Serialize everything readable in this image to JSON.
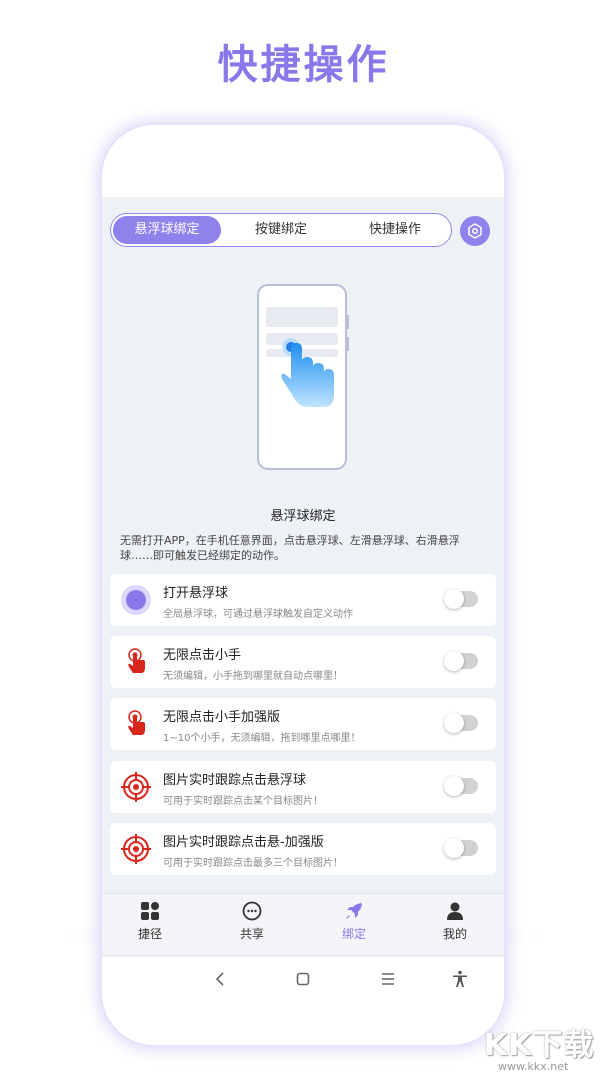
{
  "headline": "快捷操作",
  "segment": {
    "tabs": [
      {
        "label": "悬浮球绑定",
        "active": true
      },
      {
        "label": "按键绑定",
        "active": false
      },
      {
        "label": "快捷操作",
        "active": false
      }
    ],
    "settings_icon": "hexagon-settings-icon"
  },
  "section": {
    "title": "悬浮球绑定",
    "description": "无需打开APP，在手机任意界面，点击悬浮球、左滑悬浮球、右滑悬浮球……即可触发已经绑定的动作。"
  },
  "features": [
    {
      "title": "打开悬浮球",
      "subtitle": "全局悬浮球，可通过悬浮球触发自定义动作",
      "icon": "floating-ball-icon",
      "enabled": false
    },
    {
      "title": "无限点击小手",
      "subtitle": "无须编辑，小手拖到哪里就自动点哪里！",
      "icon": "tap-hand-icon",
      "enabled": false
    },
    {
      "title": "无限点击小手加强版",
      "subtitle": "1~10个小手，无须编辑，拖到哪里点哪里！",
      "icon": "tap-hand-icon",
      "enabled": false
    },
    {
      "title": "图片实时跟踪点击悬浮球",
      "subtitle": "可用于实时跟踪点击某个目标图片！",
      "icon": "target-icon",
      "enabled": false
    },
    {
      "title": "图片实时跟踪点击悬-加强版",
      "subtitle": "可用于实时跟踪点击最多三个目标图片！",
      "icon": "target-icon",
      "enabled": false
    }
  ],
  "tabbar": [
    {
      "label": "捷径",
      "icon": "grid-icon",
      "active": false
    },
    {
      "label": "共享",
      "icon": "chat-bubble-icon",
      "active": false
    },
    {
      "label": "绑定",
      "icon": "rocket-icon",
      "active": true
    },
    {
      "label": "我的",
      "icon": "person-icon",
      "active": false
    }
  ],
  "watermark": {
    "brand": "KK下载",
    "url": "www.kkx.net"
  },
  "colors": {
    "accent": "#8a78ea",
    "toggle_off": "#d2d2d2",
    "target_red": "#d8261c",
    "screen_bg": "#eef1f5"
  }
}
